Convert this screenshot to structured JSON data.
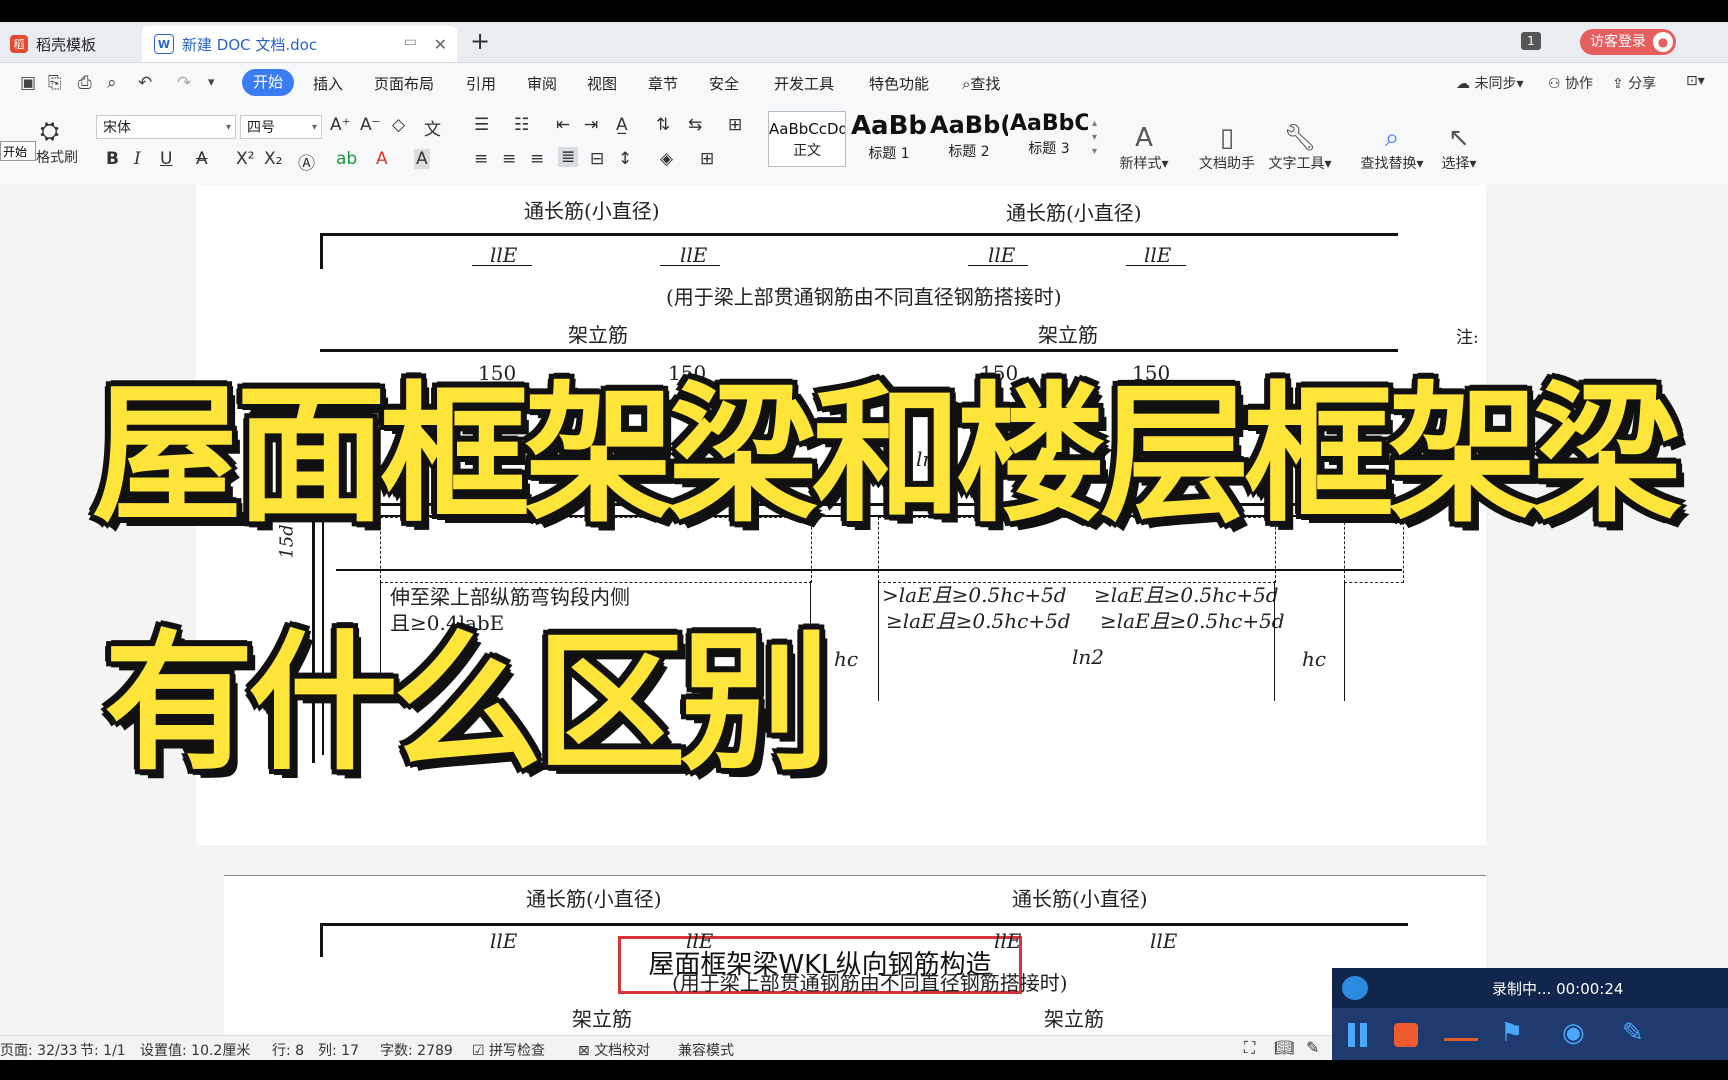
{
  "tabs": [
    {
      "label": "稻壳模板",
      "icon": "daoke-logo-icon"
    },
    {
      "label": "新建 DOC 文档.doc",
      "icon": "word-doc-icon"
    }
  ],
  "titlebar": {
    "page_count": "1",
    "login_label": "访客登录"
  },
  "menu": {
    "items": [
      "开始",
      "插入",
      "页面布局",
      "引用",
      "审阅",
      "视图",
      "章节",
      "安全",
      "开发工具",
      "特色功能"
    ],
    "search_label": "查找",
    "right": [
      "未同步",
      "协作",
      "分享"
    ]
  },
  "ribbon": {
    "format_painter": "格式刷",
    "start_popup": "开始",
    "font_name": "宋体",
    "font_size": "四号",
    "styles": [
      {
        "sample": "AaBbCcDd",
        "label": "正文"
      },
      {
        "sample": "AaBb",
        "label": "标题 1"
      },
      {
        "sample": "AaBb(",
        "label": "标题 2"
      },
      {
        "sample": "AaBbC(",
        "label": "标题 3"
      }
    ],
    "new_style": "新样式",
    "tools": [
      "文档助手",
      "文字工具",
      "查找替换",
      "选择"
    ]
  },
  "document": {
    "labels": {
      "top_rebar": "通长筋(小直径)",
      "lap_note": "(用于梁上部贯通钢筋由不同直径钢筋搭接时)",
      "erection": "架立筋",
      "note": "注:",
      "hook_text_1": "伸至梁上部纵筋弯钩段内侧",
      "hook_text_2": "且≥0.4labE",
      "anchor_1": ">laE且≥0.5hc+5d",
      "anchor_2": "≥laE且≥0.5hc+5d",
      "anchor_3": "≥laE且≥0.5hc+5d",
      "anchor_4": "≥laE且≥0.5hc+5d",
      "lap_len": "llE",
      "dim150": "150",
      "hc": "hc",
      "ln2": "ln2",
      "ln": "ln",
      "d15": "15d",
      "caption": "屋面框架梁WKL纵向钢筋构造"
    }
  },
  "overlay": {
    "line1": "屋面框架梁和楼层框架梁",
    "line2": "有什么区别"
  },
  "statusbar": {
    "page": "页面: 32/33",
    "section": "节: 1/1",
    "setting": "设置值: 10.2厘米",
    "row": "行: 8",
    "col": "列: 17",
    "words": "字数: 2789",
    "spell": "拼写检查",
    "proof": "文档校对",
    "compat": "兼容模式"
  },
  "recorder": {
    "status": "录制中... 00:00:24"
  },
  "colors": {
    "accent": "#3b7cf2",
    "title_yellow": "#ffe43a",
    "caption_red": "#d9343a",
    "login_red": "#e65e5e"
  }
}
